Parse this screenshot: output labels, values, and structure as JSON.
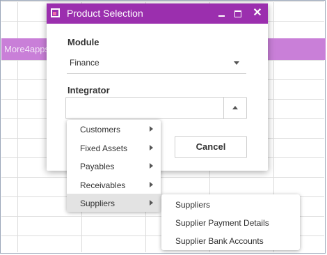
{
  "background": {
    "banner_text": "More4apps"
  },
  "dialog": {
    "title": "Product Selection",
    "accent_color": "#9b2fae",
    "controls": {
      "minimize": "minimize-icon",
      "maximize": "maximize-icon",
      "close": "✕"
    },
    "module": {
      "label": "Module",
      "value": "Finance"
    },
    "integrator": {
      "label": "Integrator",
      "value": ""
    },
    "cancel_label": "Cancel"
  },
  "menu": {
    "items": [
      {
        "label": "Customers",
        "has_submenu": true
      },
      {
        "label": "Fixed Assets",
        "has_submenu": true
      },
      {
        "label": "Payables",
        "has_submenu": true
      },
      {
        "label": "Receivables",
        "has_submenu": true
      },
      {
        "label": "Suppliers",
        "has_submenu": true,
        "active": true
      }
    ],
    "submenu": {
      "items": [
        {
          "label": "Suppliers"
        },
        {
          "label": "Supplier Payment Details"
        },
        {
          "label": "Supplier Bank Accounts"
        }
      ]
    }
  }
}
